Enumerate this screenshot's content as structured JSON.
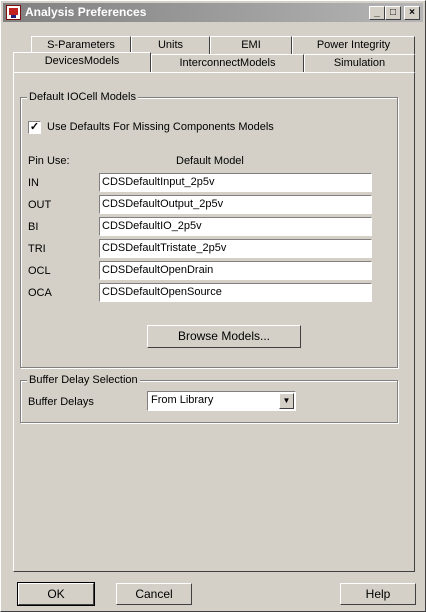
{
  "window": {
    "title": "Analysis Preferences",
    "controls": {
      "minimize": "_",
      "maximize": "□",
      "close": "×"
    }
  },
  "tabs": {
    "row1": [
      "S-Parameters",
      "Units",
      "EMI",
      "Power Integrity"
    ],
    "row2": [
      "DevicesModels",
      "InterconnectModels",
      "Simulation"
    ],
    "active": "DevicesModels"
  },
  "default_iocell": {
    "legend": "Default IOCell Models",
    "use_defaults_label": "Use Defaults For Missing Components Models",
    "use_defaults_checked": true,
    "checkmark": "✓",
    "col_pin_use": "Pin Use:",
    "col_default_model": "Default Model",
    "rows": [
      {
        "pin": "IN",
        "model": "CDSDefaultInput_2p5v"
      },
      {
        "pin": "OUT",
        "model": "CDSDefaultOutput_2p5v"
      },
      {
        "pin": "BI",
        "model": "CDSDefaultIO_2p5v"
      },
      {
        "pin": "TRI",
        "model": "CDSDefaultTristate_2p5v"
      },
      {
        "pin": "OCL",
        "model": "CDSDefaultOpenDrain"
      },
      {
        "pin": "OCA",
        "model": "CDSDefaultOpenSource"
      }
    ],
    "browse_label": "Browse Models..."
  },
  "buffer_delay": {
    "legend": "Buffer Delay Selection",
    "label": "Buffer Delays",
    "selected": "From Library",
    "arrow": "▼"
  },
  "buttons": {
    "ok": "OK",
    "cancel": "Cancel",
    "help": "Help"
  }
}
